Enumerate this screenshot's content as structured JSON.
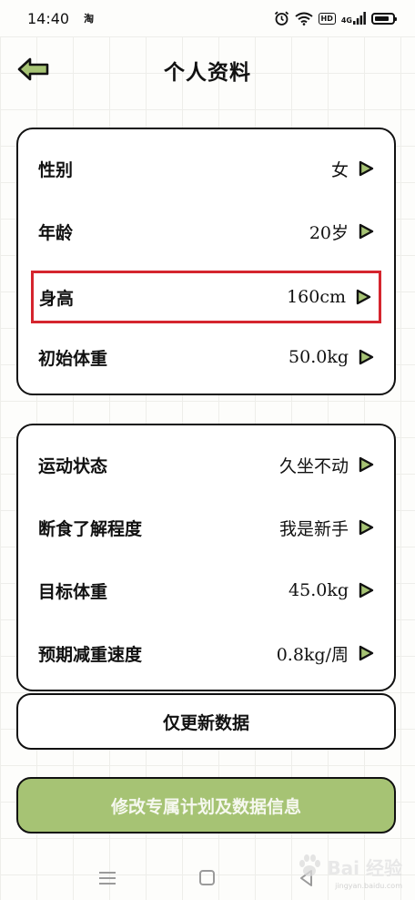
{
  "status_bar": {
    "time": "14:40",
    "app_indicator": "淘",
    "network_badge": "HD",
    "signal_label": "4G",
    "battery_level": 0.85
  },
  "header": {
    "title": "个人资料",
    "back_icon": "back-arrow-icon"
  },
  "colors": {
    "accent_green": "#a6c374",
    "highlight_red": "#d5252e",
    "arrow_fill": "#a6c374"
  },
  "card_basic": {
    "rows": [
      {
        "label": "性别",
        "value": "女"
      },
      {
        "label": "年龄",
        "value": "20岁"
      },
      {
        "label": "身高",
        "value": "160cm"
      },
      {
        "label": "初始体重",
        "value": "50.0kg"
      }
    ]
  },
  "card_plan": {
    "rows": [
      {
        "label": "运动状态",
        "value": "久坐不动"
      },
      {
        "label": "断食了解程度",
        "value": "我是新手"
      },
      {
        "label": "目标体重",
        "value": "45.0kg"
      },
      {
        "label": "预期减重速度",
        "value": "0.8kg/周"
      }
    ]
  },
  "buttons": {
    "update_only": "仅更新数据",
    "modify_plan": "修改专属计划及数据信息"
  },
  "watermark": {
    "brand": "Bai 经验",
    "url": "jingyan.baidu.com"
  }
}
